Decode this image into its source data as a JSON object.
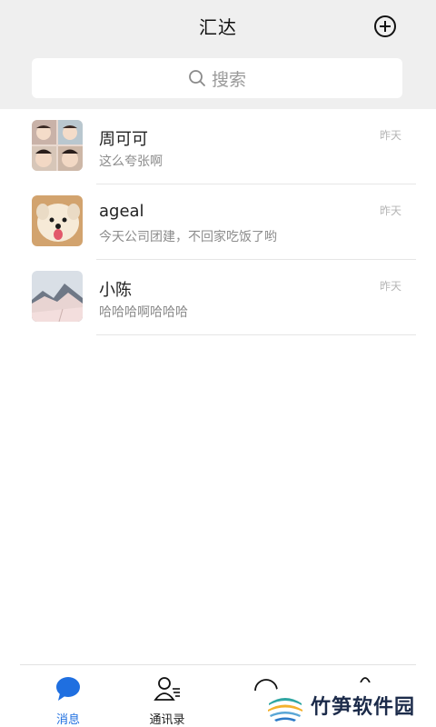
{
  "header": {
    "title": "汇达",
    "add_icon": "plus-circle-icon"
  },
  "search": {
    "placeholder": "搜索",
    "icon": "search-icon"
  },
  "conversations": [
    {
      "name": "周可可",
      "preview": "这么夸张啊",
      "time": "昨天",
      "avatar": "collage-photo"
    },
    {
      "name": "ageal",
      "preview": "今天公司团建，不回家吃饭了哟",
      "time": "昨天",
      "avatar": "dog-photo"
    },
    {
      "name": "小陈",
      "preview": "哈哈哈啊哈哈哈",
      "time": "昨天",
      "avatar": "mountain-photo"
    }
  ],
  "nav": {
    "items": [
      {
        "label": "消息",
        "icon": "message-bubble-icon",
        "active": true
      },
      {
        "label": "通讯录",
        "icon": "contacts-icon",
        "active": false
      }
    ],
    "active_color": "#1f6fe0"
  },
  "watermark": {
    "text": "竹笋软件园"
  }
}
